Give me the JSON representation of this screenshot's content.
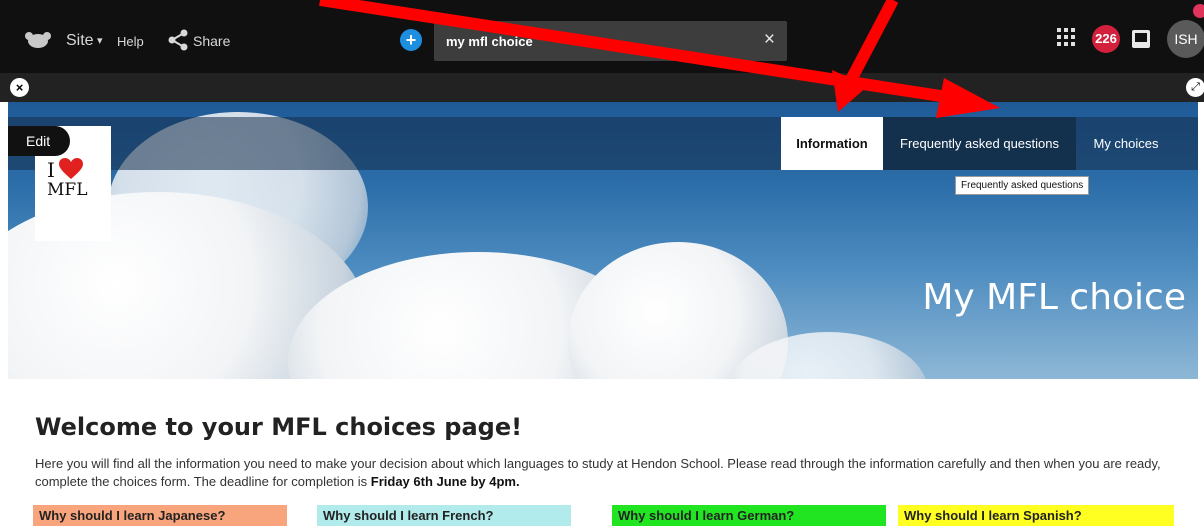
{
  "topbar": {
    "site_label": "Site",
    "site_caret": "▾",
    "help_label": "Help",
    "share_label": "Share",
    "add_icon": "+",
    "search_value": "my mfl choice",
    "search_clear": "×",
    "notifications_count": "226",
    "avatar_initials": "ISH"
  },
  "subbar": {
    "close_icon": "×",
    "expand_icon": "⤢"
  },
  "edit_label": "Edit",
  "banner": {
    "tabs": [
      {
        "label": "Information"
      },
      {
        "label": "Frequently asked questions"
      },
      {
        "label": "My choices"
      }
    ],
    "tooltip": "Frequently asked questions",
    "logo_line1": "I",
    "logo_line2": "MFL",
    "hero_title": "My MFL choice"
  },
  "content": {
    "heading": "Welcome to your MFL choices page!",
    "intro_text": "Here you will find all the information you need to make your decision about which languages to study at Hendon School. Please read through the information carefully and then when you are ready, complete the choices form. The deadline for completion is ",
    "deadline": "Friday 6th June by 4pm.",
    "languages": [
      {
        "label": "Why should I learn Japanese?",
        "color": "#f8a57d"
      },
      {
        "label": "Why should I learn French?",
        "color": "#b2ebeb"
      },
      {
        "label": "Why should I learn German?",
        "color": "#22e522"
      },
      {
        "label": "Why should I learn Spanish?",
        "color": "#ffff22"
      }
    ]
  },
  "colors": {
    "topbar_bg": "#101010",
    "accent_blue": "#1e8ee0",
    "badge_red": "#d3213d",
    "arrow_red": "#ff0000"
  }
}
